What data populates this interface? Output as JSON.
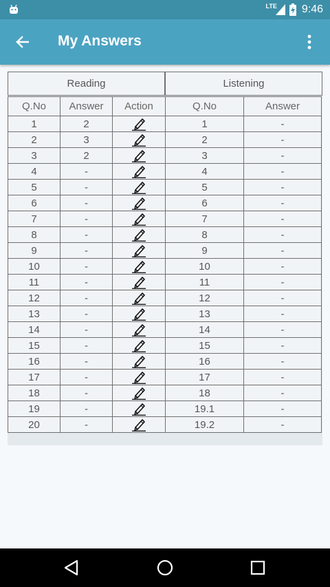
{
  "status": {
    "network_label": "LTE",
    "time": "9:46"
  },
  "appbar": {
    "title": "My Answers",
    "back_icon": "arrow-back-icon",
    "more_icon": "more-vert-icon"
  },
  "sections": {
    "reading": "Reading",
    "listening": "Listening"
  },
  "columns": {
    "r_qno": "Q.No",
    "r_answer": "Answer",
    "r_action": "Action",
    "l_qno": "Q.No",
    "l_answer": "Answer"
  },
  "rows": [
    {
      "r_qno": "1",
      "r_answer": "2",
      "l_qno": "1",
      "l_answer": "-"
    },
    {
      "r_qno": "2",
      "r_answer": "3",
      "l_qno": "2",
      "l_answer": "-"
    },
    {
      "r_qno": "3",
      "r_answer": "2",
      "l_qno": "3",
      "l_answer": "-"
    },
    {
      "r_qno": "4",
      "r_answer": "-",
      "l_qno": "4",
      "l_answer": "-"
    },
    {
      "r_qno": "5",
      "r_answer": "-",
      "l_qno": "5",
      "l_answer": "-"
    },
    {
      "r_qno": "6",
      "r_answer": "-",
      "l_qno": "6",
      "l_answer": "-"
    },
    {
      "r_qno": "7",
      "r_answer": "-",
      "l_qno": "7",
      "l_answer": "-"
    },
    {
      "r_qno": "8",
      "r_answer": "-",
      "l_qno": "8",
      "l_answer": "-"
    },
    {
      "r_qno": "9",
      "r_answer": "-",
      "l_qno": "9",
      "l_answer": "-"
    },
    {
      "r_qno": "10",
      "r_answer": "-",
      "l_qno": "10",
      "l_answer": "-"
    },
    {
      "r_qno": "11",
      "r_answer": "-",
      "l_qno": "11",
      "l_answer": "-"
    },
    {
      "r_qno": "12",
      "r_answer": "-",
      "l_qno": "12",
      "l_answer": "-"
    },
    {
      "r_qno": "13",
      "r_answer": "-",
      "l_qno": "13",
      "l_answer": "-"
    },
    {
      "r_qno": "14",
      "r_answer": "-",
      "l_qno": "14",
      "l_answer": "-"
    },
    {
      "r_qno": "15",
      "r_answer": "-",
      "l_qno": "15",
      "l_answer": "-"
    },
    {
      "r_qno": "16",
      "r_answer": "-",
      "l_qno": "16",
      "l_answer": "-"
    },
    {
      "r_qno": "17",
      "r_answer": "-",
      "l_qno": "17",
      "l_answer": "-"
    },
    {
      "r_qno": "18",
      "r_answer": "-",
      "l_qno": "18",
      "l_answer": "-"
    },
    {
      "r_qno": "19",
      "r_answer": "-",
      "l_qno": "19.1",
      "l_answer": "-"
    },
    {
      "r_qno": "20",
      "r_answer": "-",
      "l_qno": "19.2",
      "l_answer": "-"
    }
  ],
  "icons": {
    "edit": "pencil-icon",
    "nav_back": "nav-back-icon",
    "nav_home": "nav-home-icon",
    "nav_recents": "nav-recents-icon"
  },
  "colors": {
    "statusbar": "#3d8ea7",
    "appbar": "#4ba3c2",
    "background": "#f5f9fc",
    "cell": "#f1f4f6",
    "border": "#6f6f6f"
  }
}
